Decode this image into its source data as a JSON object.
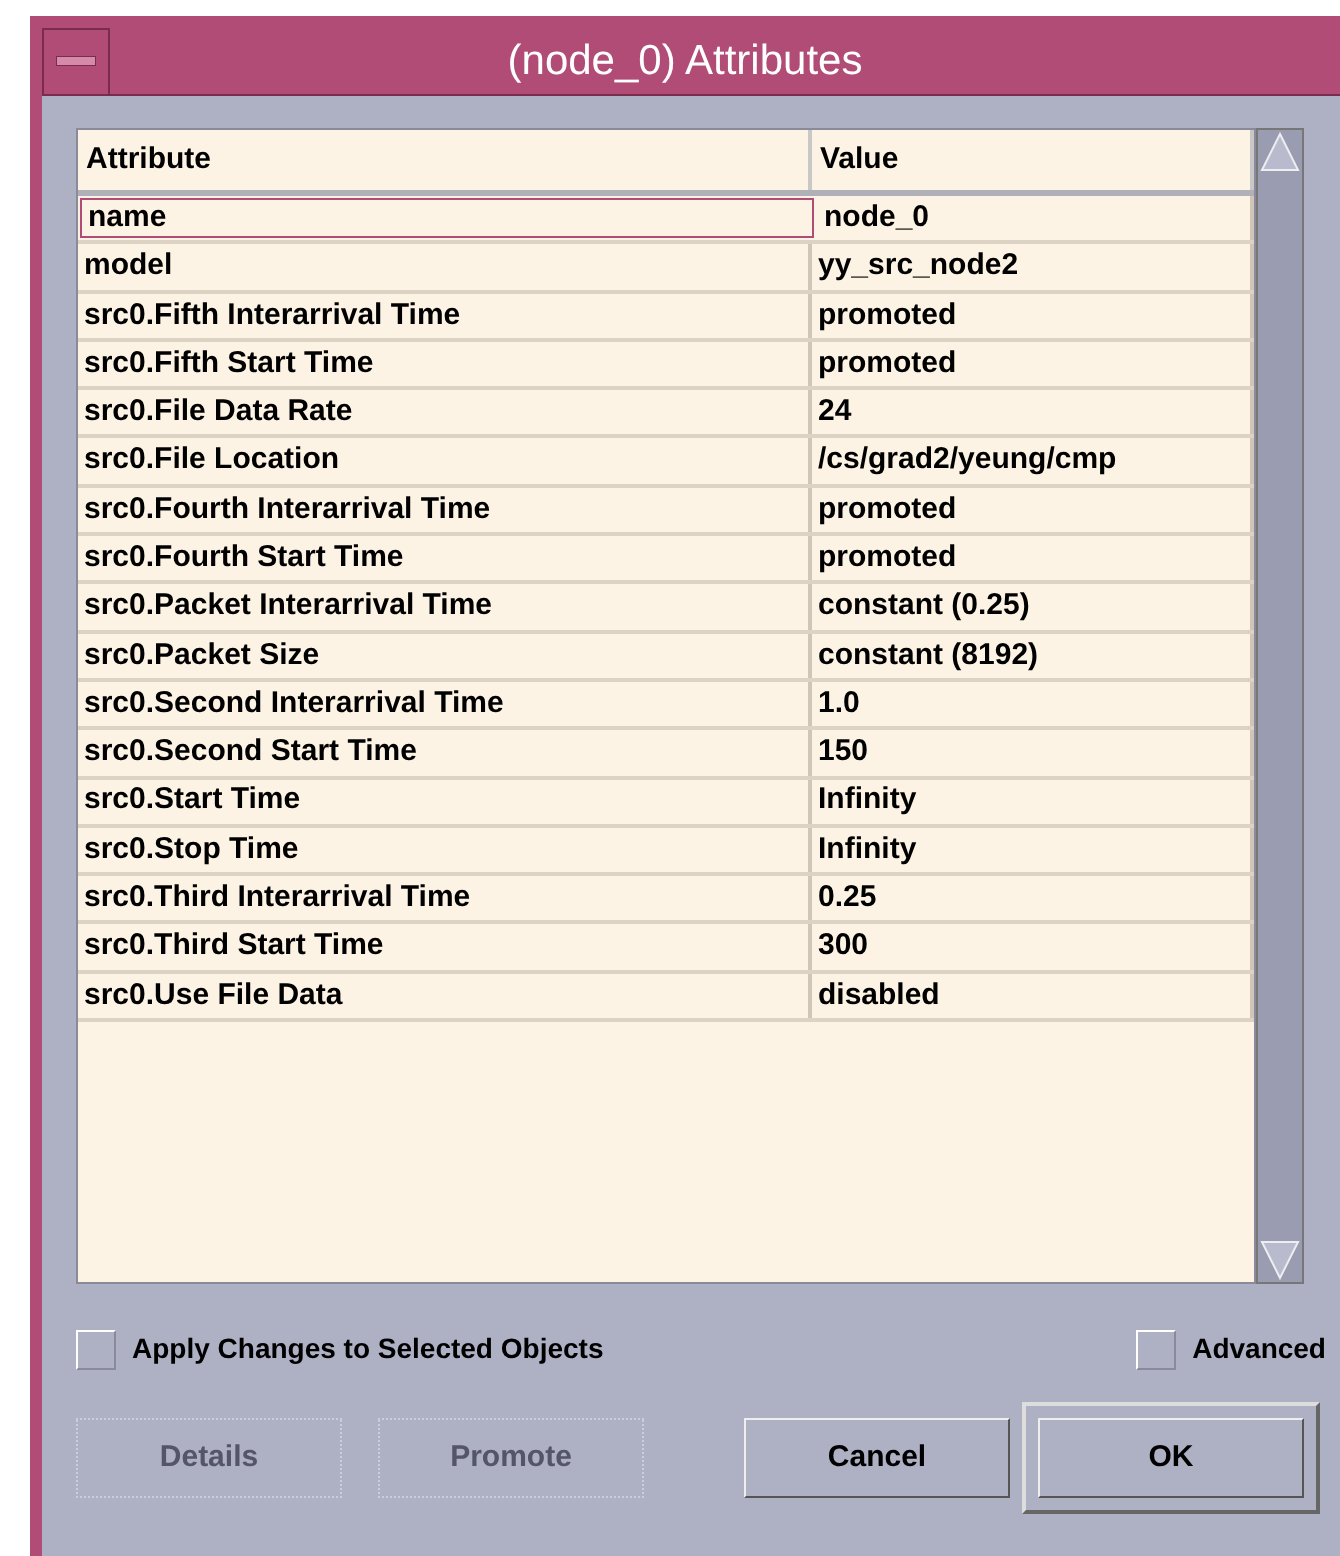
{
  "window": {
    "title": "(node_0) Attributes"
  },
  "table": {
    "columns": [
      "Attribute",
      "Value"
    ],
    "rows": [
      {
        "attribute": "name",
        "value": "node_0",
        "selected": true
      },
      {
        "attribute": "model",
        "value": "yy_src_node2",
        "selected": false
      },
      {
        "attribute": "src0.Fifth Interarrival Time",
        "value": "promoted",
        "selected": false
      },
      {
        "attribute": "src0.Fifth Start Time",
        "value": "promoted",
        "selected": false
      },
      {
        "attribute": "src0.File Data Rate",
        "value": "24",
        "selected": false
      },
      {
        "attribute": "src0.File Location",
        "value": "/cs/grad2/yeung/cmp",
        "selected": false
      },
      {
        "attribute": "src0.Fourth Interarrival Time",
        "value": "promoted",
        "selected": false
      },
      {
        "attribute": "src0.Fourth Start Time",
        "value": "promoted",
        "selected": false
      },
      {
        "attribute": "src0.Packet Interarrival Time",
        "value": "constant (0.25)",
        "selected": false
      },
      {
        "attribute": "src0.Packet Size",
        "value": "constant (8192)",
        "selected": false
      },
      {
        "attribute": "src0.Second Interarrival Time",
        "value": "1.0",
        "selected": false
      },
      {
        "attribute": "src0.Second Start Time",
        "value": "150",
        "selected": false
      },
      {
        "attribute": "src0.Start Time",
        "value": "Infinity",
        "selected": false
      },
      {
        "attribute": "src0.Stop Time",
        "value": "Infinity",
        "selected": false
      },
      {
        "attribute": "src0.Third Interarrival Time",
        "value": "0.25",
        "selected": false
      },
      {
        "attribute": "src0.Third Start Time",
        "value": "300",
        "selected": false
      },
      {
        "attribute": "src0.Use File Data",
        "value": "disabled",
        "selected": false
      }
    ]
  },
  "options": [
    {
      "label": "Apply Changes to Selected Objects",
      "checked": false
    },
    {
      "label": "Advanced",
      "checked": false
    }
  ],
  "buttons": [
    {
      "label": "Details",
      "disabled": true,
      "default": false
    },
    {
      "label": "Promote",
      "disabled": true,
      "default": false
    },
    {
      "label": "Cancel",
      "disabled": false,
      "default": false
    },
    {
      "label": "OK",
      "disabled": false,
      "default": true
    }
  ]
}
